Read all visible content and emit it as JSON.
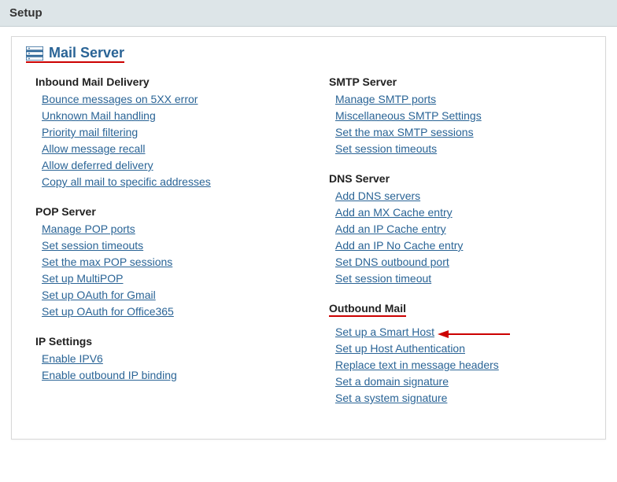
{
  "header": {
    "title": "Setup"
  },
  "page_title": "Mail Server",
  "columns": {
    "left": [
      {
        "heading": "Inbound Mail Delivery",
        "links": [
          "Bounce messages on 5XX error",
          "Unknown Mail handling",
          "Priority mail filtering",
          "Allow message recall",
          "Allow deferred delivery",
          "Copy all mail to specific addresses"
        ]
      },
      {
        "heading": "POP Server",
        "links": [
          "Manage POP ports",
          "Set session timeouts",
          "Set the max POP sessions",
          "Set up MultiPOP",
          "Set up OAuth for Gmail",
          "Set up OAuth for Office365"
        ]
      },
      {
        "heading": "IP Settings",
        "links": [
          "Enable IPV6",
          "Enable outbound IP binding"
        ]
      }
    ],
    "right": [
      {
        "heading": "SMTP Server",
        "links": [
          "Manage SMTP ports",
          "Miscellaneous SMTP Settings",
          "Set the max SMTP sessions",
          "Set session timeouts"
        ]
      },
      {
        "heading": "DNS Server",
        "links": [
          "Add DNS servers",
          "Add an MX Cache entry",
          "Add an IP Cache entry",
          "Add an IP No Cache entry",
          "Set DNS outbound port",
          "Set session timeout"
        ]
      },
      {
        "heading": "Outbound Mail",
        "links": [
          "Set up a Smart Host",
          "Set up Host Authentication",
          "Replace text in message headers",
          "Set a domain signature",
          "Set a system signature"
        ]
      }
    ]
  }
}
